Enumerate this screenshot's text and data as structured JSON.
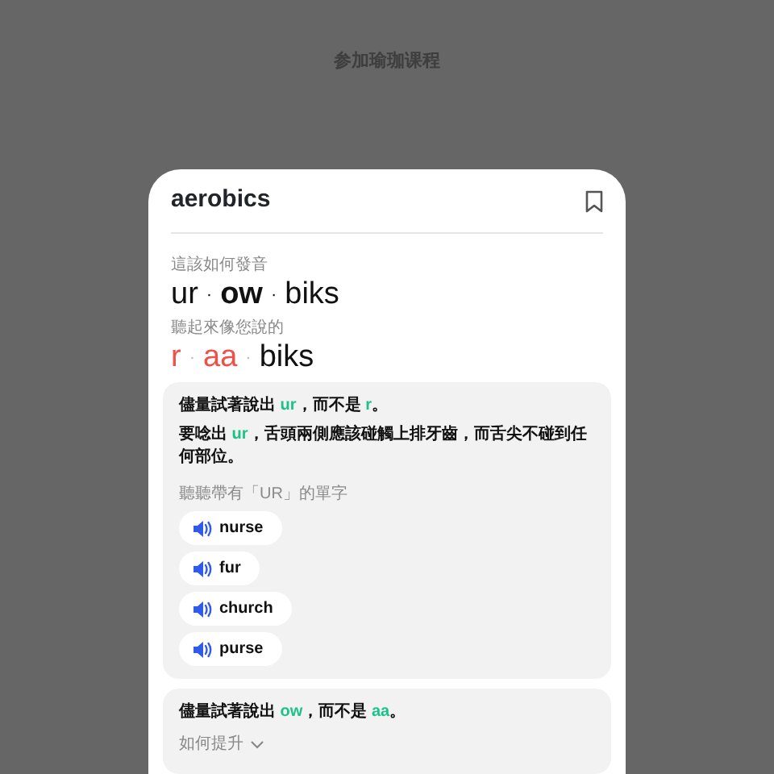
{
  "screen_title": "参加瑜珈课程",
  "word": {
    "title": "aerobics",
    "bookmarked": false
  },
  "expected": {
    "label": "這該如何發音",
    "separator": "·",
    "syllables": [
      {
        "text": "ur",
        "stressed": false
      },
      {
        "text": "ow",
        "stressed": true
      },
      {
        "text": "biks",
        "stressed": false
      }
    ]
  },
  "heard": {
    "label": "聽起來像您說的",
    "separator": "·",
    "syllables": [
      {
        "text": "r",
        "error": true
      },
      {
        "text": "aa",
        "error": true
      },
      {
        "text": "biks",
        "error": false
      }
    ]
  },
  "tips": [
    {
      "headline": [
        {
          "text": "儘量試著說出 ",
          "highlight": false
        },
        {
          "text": "ur",
          "highlight": true
        },
        {
          "text": "，而不是 ",
          "highlight": false
        },
        {
          "text": "r",
          "highlight": true
        },
        {
          "text": "。",
          "highlight": false
        }
      ],
      "expanded": true,
      "body": [
        {
          "text": "要唸出 ",
          "highlight": false
        },
        {
          "text": "ur",
          "highlight": true
        },
        {
          "text": "，舌頭兩側應該碰觸上排牙齒，而舌尖不碰到任何部位。",
          "highlight": false
        }
      ],
      "words_label": "聽聽帶有「UR」的單字",
      "words": [
        "nurse",
        "fur",
        "church",
        "purse"
      ]
    },
    {
      "headline": [
        {
          "text": "儘量試著說出 ",
          "highlight": false
        },
        {
          "text": "ow",
          "highlight": true
        },
        {
          "text": "，而不是 ",
          "highlight": false
        },
        {
          "text": "aa",
          "highlight": true
        },
        {
          "text": "。",
          "highlight": false
        }
      ],
      "expanded": false,
      "toggle_label": "如何提升"
    }
  ]
}
